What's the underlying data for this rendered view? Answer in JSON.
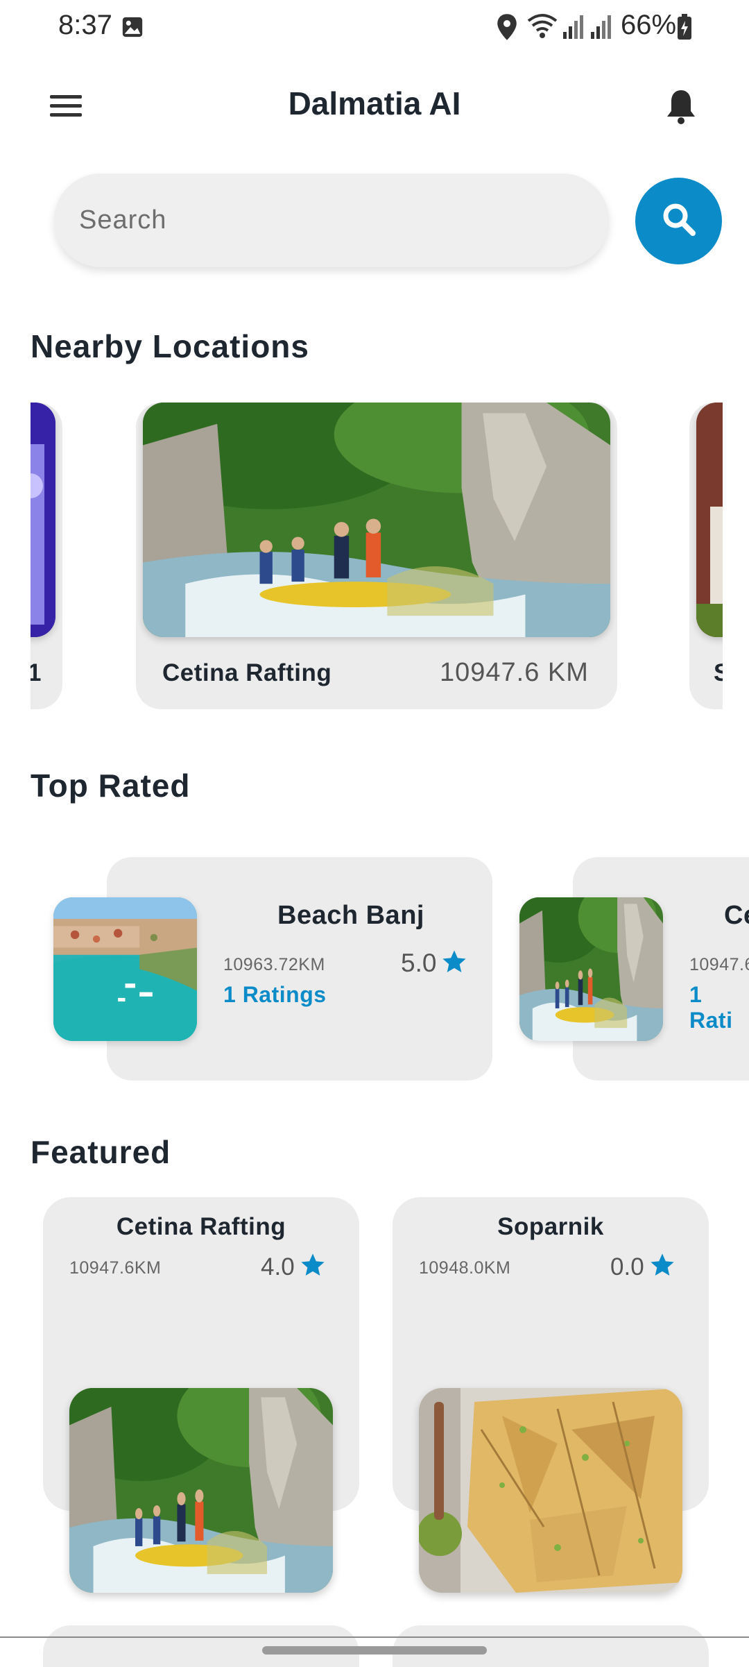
{
  "status_bar": {
    "time": "8:37",
    "battery": "66%"
  },
  "app_bar": {
    "title": "Dalmatia AI"
  },
  "search": {
    "placeholder": "Search"
  },
  "sections": {
    "nearby": "Nearby Locations",
    "top_rated": "Top Rated",
    "featured": "Featured"
  },
  "nearby": {
    "left_partial_label": "1",
    "center": {
      "name": "Cetina Rafting",
      "distance": "10947.6 KM"
    },
    "right_partial_label": "S"
  },
  "top_rated": [
    {
      "name": "Beach Banj",
      "distance": "10963.72KM",
      "rating": "5.0",
      "ratings_count": "1 Ratings"
    },
    {
      "name": "Ce",
      "distance": "10947.6",
      "ratings_count": "1 Rati"
    }
  ],
  "featured": [
    {
      "name": "Cetina Rafting",
      "distance": "10947.6KM",
      "rating": "4.0"
    },
    {
      "name": "Soparnik",
      "distance": "10948.0KM",
      "rating": "0.0"
    }
  ],
  "colors": {
    "accent": "#0b8bc7",
    "card_bg": "#ececec",
    "title": "#1e2630"
  },
  "icons": [
    "image-icon",
    "location-icon",
    "wifi-icon",
    "signal-icon",
    "battery-icon",
    "menu-icon",
    "bell-icon",
    "search-icon",
    "star-icon"
  ]
}
